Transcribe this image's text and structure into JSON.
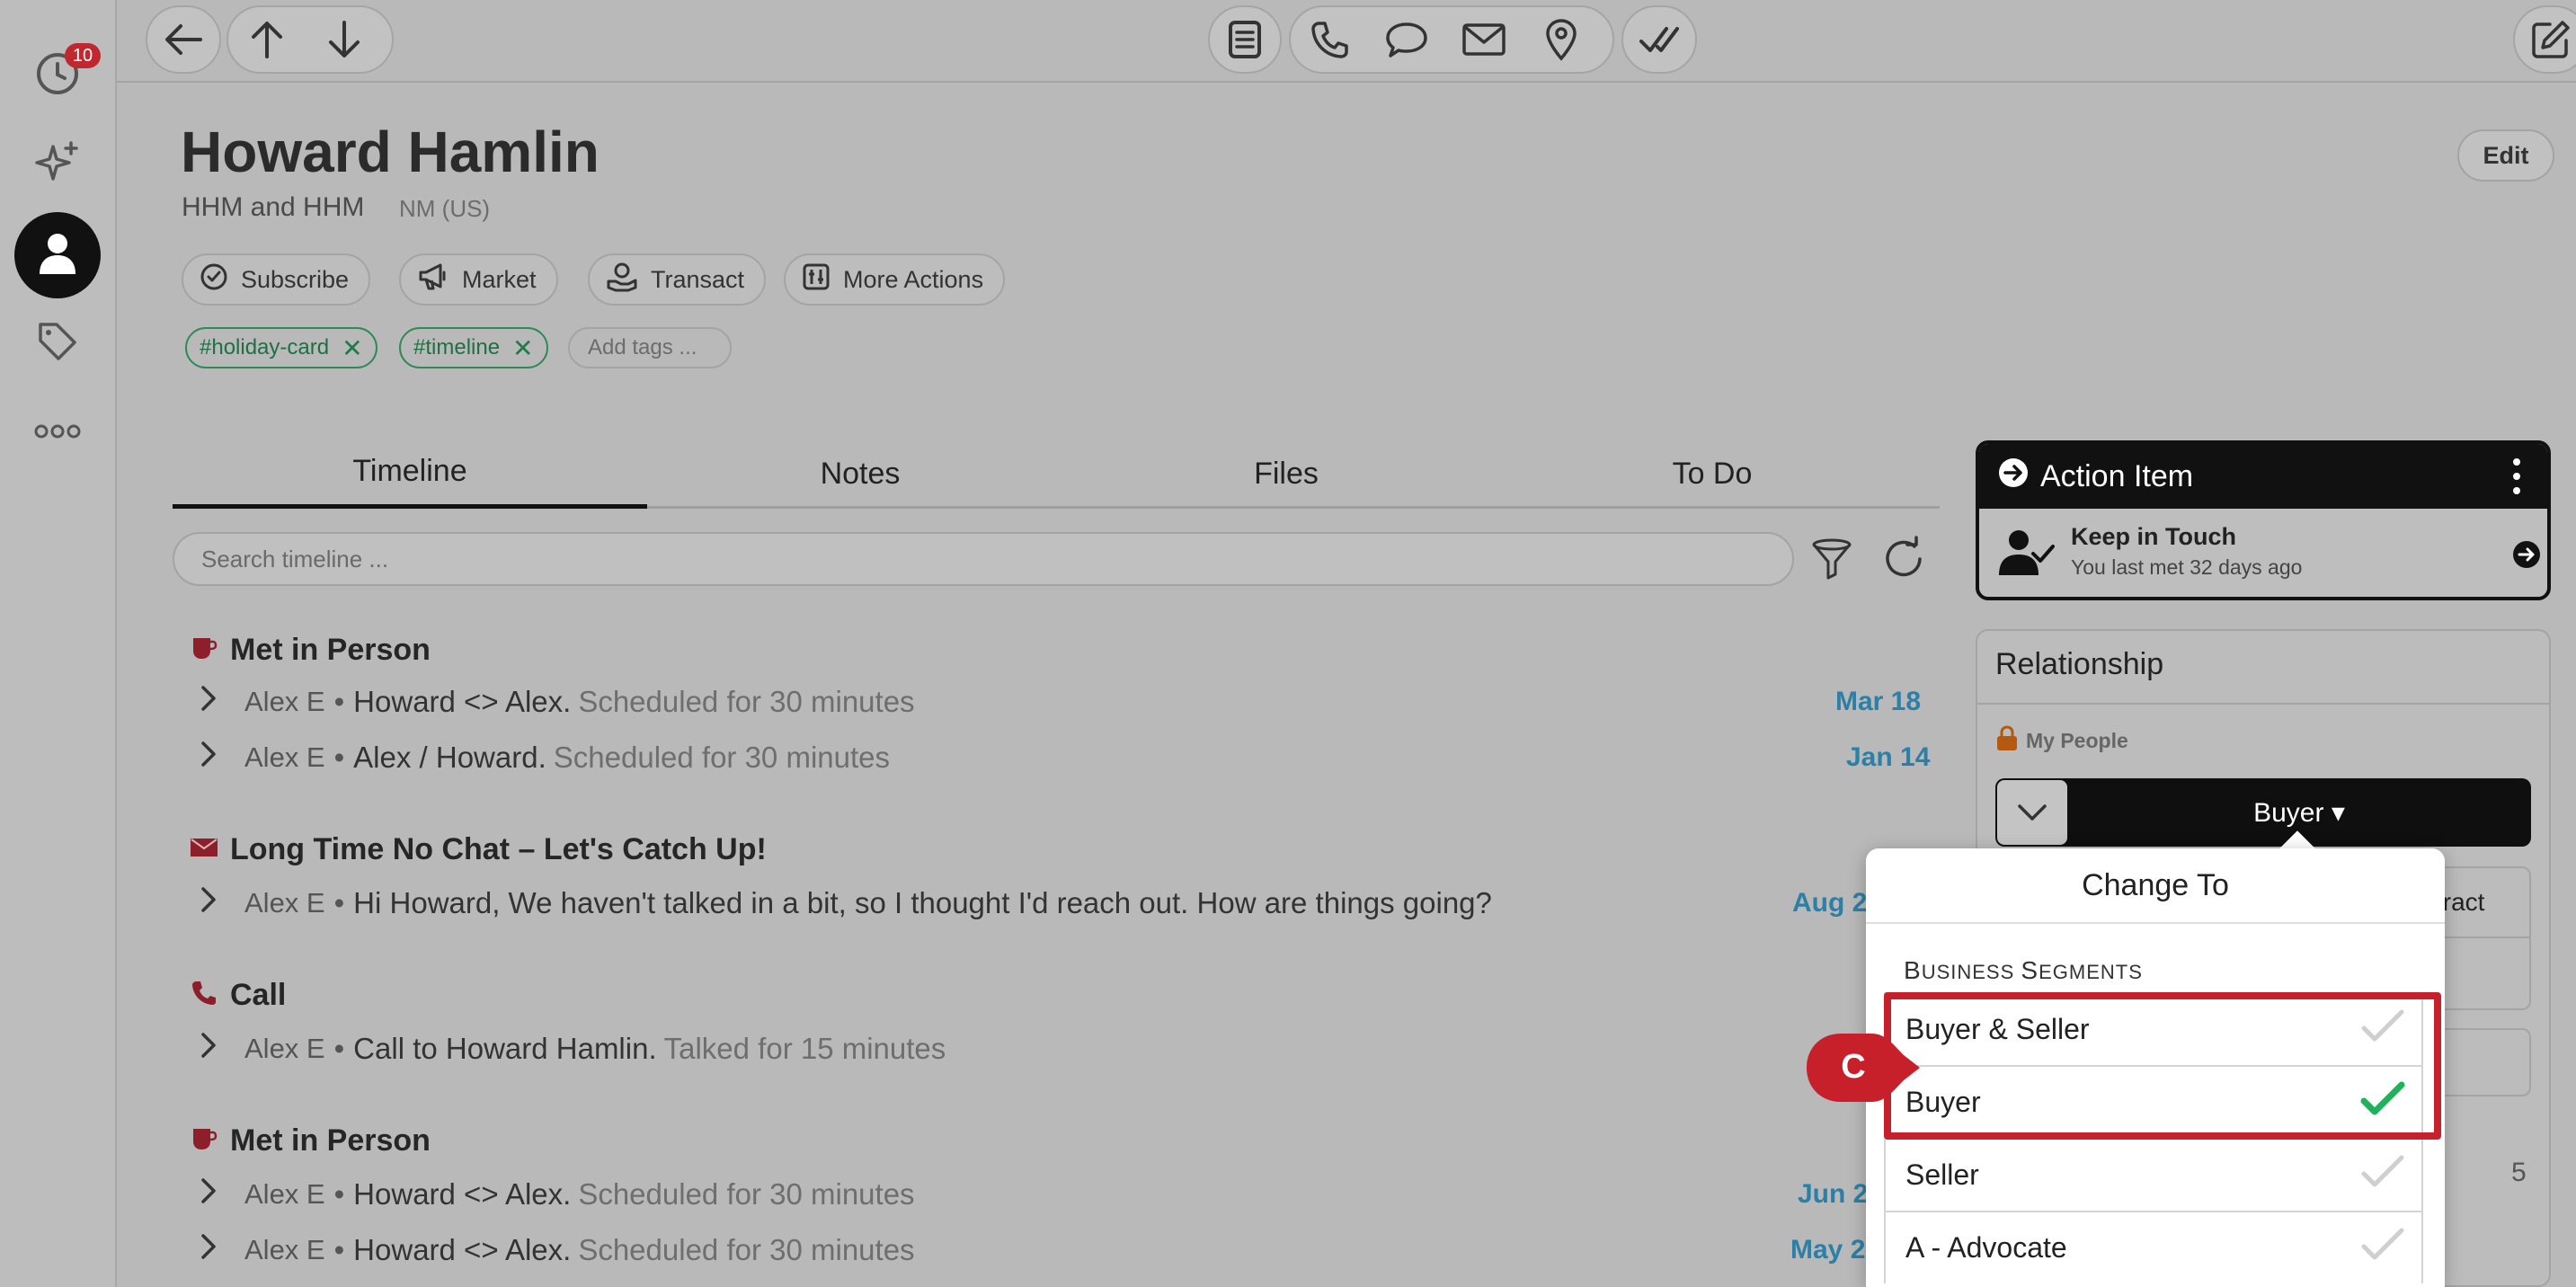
{
  "rail": {
    "badge_count": "10",
    "items": [
      "activity-icon",
      "sparkle-icon",
      "person-icon",
      "tag-icon",
      "more-icon"
    ]
  },
  "toolbar": {
    "nav_icons": [
      "back-arrow-icon",
      "up-arrow-icon",
      "down-arrow-icon"
    ],
    "action_icons": [
      "note-icon",
      "phone-icon",
      "chat-icon",
      "mail-icon",
      "location-icon",
      "check-icon"
    ],
    "compose_icon": "compose-icon"
  },
  "contact": {
    "name": "Howard Hamlin",
    "company": "HHM and HHM",
    "location": "NM (US)",
    "edit_label": "Edit"
  },
  "actions": [
    {
      "label": "Subscribe",
      "icon": "check-circle-icon"
    },
    {
      "label": "Market",
      "icon": "megaphone-icon"
    },
    {
      "label": "Transact",
      "icon": "hand-coin-icon"
    },
    {
      "label": "More Actions",
      "icon": "sliders-icon"
    }
  ],
  "tags": [
    "#holiday-card",
    "#timeline"
  ],
  "add_tags_placeholder": "Add tags ...",
  "tabs": [
    "Timeline",
    "Notes",
    "Files",
    "To Do"
  ],
  "active_tab": "Timeline",
  "search": {
    "placeholder": "Search timeline ..."
  },
  "timeline": [
    {
      "title": "Met in Person",
      "icon": "coffee-cup-icon",
      "rows": [
        {
          "who": "Alex E",
          "text": "Howard <> Alex.",
          "sub": "Scheduled for 30 minutes",
          "date": "Mar 18"
        },
        {
          "who": "Alex E",
          "text": "Alex / Howard.",
          "sub": "Scheduled for 30 minutes",
          "date": "Jan 14"
        }
      ]
    },
    {
      "title": "Long Time No Chat – Let's Catch Up!",
      "icon": "envelope-icon",
      "rows": [
        {
          "who": "Alex E",
          "text": "Hi Howard, We haven't talked in a bit, so I thought I'd reach out. How are things going?",
          "sub": "",
          "date": "Aug 2"
        }
      ]
    },
    {
      "title": "Call",
      "icon": "phone-icon",
      "rows": [
        {
          "who": "Alex E",
          "text": "Call to Howard Hamlin.",
          "sub": "Talked for 15 minutes",
          "date": ""
        }
      ]
    },
    {
      "title": "Met in Person",
      "icon": "coffee-cup-icon",
      "rows": [
        {
          "who": "Alex E",
          "text": "Howard <> Alex.",
          "sub": "Scheduled for 30 minutes",
          "date": "Jun 2"
        },
        {
          "who": "Alex E",
          "text": "Howard <> Alex.",
          "sub": "Scheduled for 30 minutes",
          "date": "May 2"
        }
      ]
    }
  ],
  "action_item": {
    "title": "Action Item",
    "item_title": "Keep in Touch",
    "item_sub": "You last met 32 days ago"
  },
  "relationship": {
    "title": "Relationship",
    "my_people": "My People",
    "segment": "Buyer ▾",
    "peek_text": "tract",
    "count": "5"
  },
  "popover": {
    "title": "Change To",
    "section": "Business Segments",
    "options": [
      {
        "label": "Buyer & Seller",
        "selected": false
      },
      {
        "label": "Buyer",
        "selected": true
      },
      {
        "label": "Seller",
        "selected": false
      },
      {
        "label": "A - Advocate",
        "selected": false
      }
    ]
  },
  "annotation": {
    "marker": "C"
  },
  "colors": {
    "accent_green": "#2e8b57",
    "date_blue": "#2c7fa6",
    "highlight_red": "#c8202b",
    "badge_red": "#c0282f",
    "check_green": "#1fb25a"
  }
}
